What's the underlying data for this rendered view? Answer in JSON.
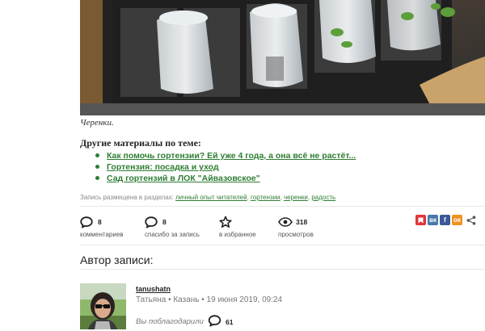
{
  "photo": {
    "alt": "seedlings-under-plastic-cups"
  },
  "caption": "Черенки.",
  "related": {
    "title": "Другие материалы по теме:",
    "items": [
      {
        "label": "Как помочь гортензии? Ей уже 4 года, а она всё не растёт..."
      },
      {
        "label": "Гортензия: посадка и уход"
      },
      {
        "label": "Сад гортензий в ЛОК \"Айвазовское\""
      }
    ]
  },
  "sections": {
    "prefix": "Запись размещена в разделах:",
    "tags": [
      "личный опыт читателей",
      "гортензии",
      "черенки",
      "радость"
    ]
  },
  "stats": {
    "comments": {
      "count": "8",
      "label": "комментариев"
    },
    "thanks": {
      "count": "8",
      "label": "спасибо за запись"
    },
    "favorite": {
      "label": "в избранное"
    },
    "views": {
      "count": "318",
      "label": "просмотров"
    }
  },
  "share": {
    "items": [
      {
        "name": "bookmark",
        "color": "#e0343b"
      },
      {
        "name": "vk",
        "text": "вк",
        "color": "#4a76a8"
      },
      {
        "name": "facebook",
        "text": "f",
        "color": "#3b5998"
      },
      {
        "name": "odnoklassniki",
        "text": "ок",
        "color": "#f09123"
      }
    ]
  },
  "author": {
    "title": "Автор записи:",
    "username": "tanushatn",
    "meta": "Татьяна • Казань • 19 июня 2019, 09:24",
    "thanks_text": "Вы поблагодарили",
    "thanks_count": "61"
  }
}
